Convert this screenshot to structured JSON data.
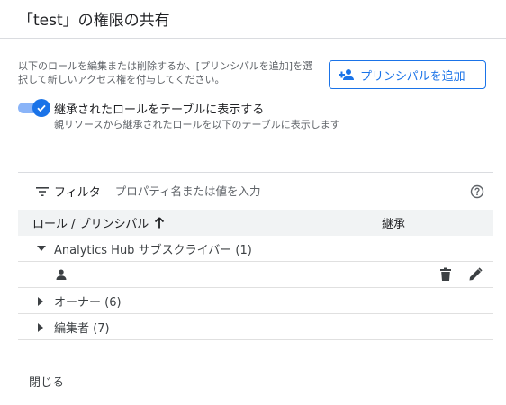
{
  "dialog": {
    "title": "「test」の権限の共有",
    "description": "以下のロールを編集または削除するか、[プリンシパルを追加]を選択して新しいアクセス権を付与してください。",
    "add_principal_label": "プリンシパルを追加",
    "close_label": "閉じる"
  },
  "toggle": {
    "label": "継承されたロールをテーブルに表示する",
    "sublabel": "親リソースから継承されたロールを以下のテーブルに表示します",
    "checked": true
  },
  "filter": {
    "label": "フィルタ",
    "placeholder": "プロパティ名または値を入力"
  },
  "table": {
    "headers": {
      "role": "ロール / プリンシパル",
      "inherited": "継承"
    },
    "groups": [
      {
        "label": "Analytics Hub サブスクライバー (1)",
        "expanded": true
      },
      {
        "label": "オーナー (6)",
        "expanded": false
      },
      {
        "label": "編集者 (7)",
        "expanded": false
      }
    ]
  },
  "colors": {
    "accent": "#1a73e8",
    "header_bg": "#f1f3f4",
    "divider": "#dadce0",
    "icon": "#5f6368"
  }
}
